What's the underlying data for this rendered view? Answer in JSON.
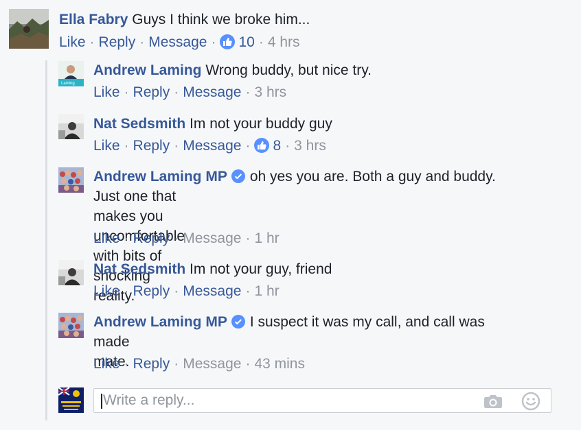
{
  "comments": [
    {
      "author": "Ella Fabry",
      "text": "Guys I think we broke him...",
      "like_label": "Like",
      "reply_label": "Reply",
      "message_label": "Message",
      "reaction_count": "10",
      "time": "4 hrs"
    },
    {
      "author": "Andrew Laming",
      "text": "Wrong buddy, but nice try.",
      "like_label": "Like",
      "reply_label": "Reply",
      "message_label": "Message",
      "time": "3 hrs",
      "avatar_text": "Laming"
    },
    {
      "author": "Nat Sedsmith",
      "text": "Im not your buddy guy",
      "like_label": "Like",
      "reply_label": "Reply",
      "message_label": "Message",
      "reaction_count": "8",
      "time": "3 hrs"
    },
    {
      "author": "Andrew Laming MP",
      "text_line1": "oh yes you are. Both a guy and buddy.",
      "text_line2": "Just one that makes you uncomfortable with bits of shocking",
      "text_line3": "reality.",
      "like_label": "Like",
      "reply_label": "Reply",
      "message_label": "Message",
      "time": "1 hr"
    },
    {
      "author": "Nat Sedsmith",
      "text": "Im not your guy, friend",
      "like_label": "Like",
      "reply_label": "Reply",
      "message_label": "Message",
      "time": "1 hr"
    },
    {
      "author": "Andrew Laming MP",
      "text_line1": "I suspect it was my call, and call was",
      "text_line2": "made mate.",
      "like_label": "Like",
      "reply_label": "Reply",
      "message_label": "Message",
      "time": "43 mins"
    }
  ],
  "reply_input": {
    "placeholder": "Write a reply..."
  },
  "icons": {
    "reaction": "thumbs-up-icon",
    "verified": "verified-badge-icon",
    "camera": "camera-icon",
    "emoji": "smiley-icon"
  },
  "colors": {
    "background": "#f6f7f9",
    "link": "#365899",
    "muted": "#90949c",
    "like_blue": "#5890ff"
  }
}
